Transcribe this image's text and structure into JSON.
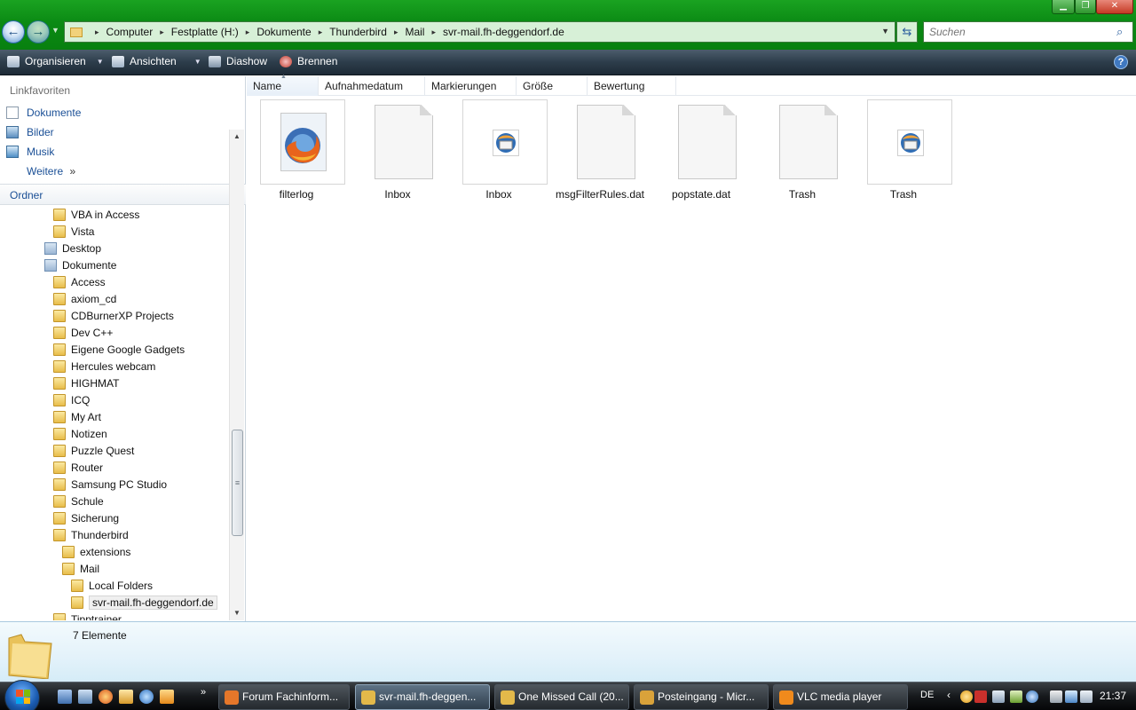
{
  "window": {
    "controls": {
      "minimize": "▁",
      "maximize": "❐",
      "close": "✕"
    }
  },
  "address": {
    "crumbs": [
      "Computer",
      "Festplatte (H:)",
      "Dokumente",
      "Thunderbird",
      "Mail",
      "svr-mail.fh-deggendorf.de"
    ],
    "separator": "▸"
  },
  "search": {
    "placeholder": "Suchen",
    "icon": "search-icon"
  },
  "commandbar": {
    "organize": "Organisieren",
    "views": "Ansichten",
    "slideshow": "Diashow",
    "burn": "Brennen",
    "help": "?"
  },
  "sidebar": {
    "favorites_title": "Linkfavoriten",
    "favorites": [
      {
        "label": "Dokumente",
        "icon": "document-icon"
      },
      {
        "label": "Bilder",
        "icon": "pictures-icon"
      },
      {
        "label": "Musik",
        "icon": "music-icon"
      }
    ],
    "more_label": "Weitere",
    "more_chevron": "»",
    "folders_title": "Ordner",
    "folders_chevron": "⌄",
    "tree": [
      {
        "label": "VBA in Access",
        "type": "folder",
        "depth": 2
      },
      {
        "label": "Vista",
        "type": "folder",
        "depth": 2
      },
      {
        "label": "Desktop",
        "type": "library",
        "depth": 1
      },
      {
        "label": "Dokumente",
        "type": "library",
        "depth": 1
      },
      {
        "label": "Access",
        "type": "folder",
        "depth": 2
      },
      {
        "label": "axiom_cd",
        "type": "folder",
        "depth": 2
      },
      {
        "label": "CDBurnerXP Projects",
        "type": "folder",
        "depth": 2
      },
      {
        "label": "Dev C++",
        "type": "folder",
        "depth": 2
      },
      {
        "label": "Eigene Google Gadgets",
        "type": "folder",
        "depth": 2
      },
      {
        "label": "Hercules webcam",
        "type": "folder",
        "depth": 2
      },
      {
        "label": "HIGHMAT",
        "type": "folder",
        "depth": 2
      },
      {
        "label": "ICQ",
        "type": "folder",
        "depth": 2
      },
      {
        "label": "My Art",
        "type": "folder",
        "depth": 2
      },
      {
        "label": "Notizen",
        "type": "folder",
        "depth": 2
      },
      {
        "label": "Puzzle Quest",
        "type": "folder",
        "depth": 2
      },
      {
        "label": "Router",
        "type": "folder",
        "depth": 2
      },
      {
        "label": "Samsung PC Studio",
        "type": "folder",
        "depth": 2
      },
      {
        "label": "Schule",
        "type": "folder",
        "depth": 2
      },
      {
        "label": "Sicherung",
        "type": "folder",
        "depth": 2
      },
      {
        "label": "Thunderbird",
        "type": "folder",
        "depth": 2
      },
      {
        "label": "extensions",
        "type": "folder",
        "depth": 3
      },
      {
        "label": "Mail",
        "type": "folder",
        "depth": 3
      },
      {
        "label": "Local Folders",
        "type": "folder",
        "depth": 4
      },
      {
        "label": "svr-mail.fh-deggendorf.de",
        "type": "folder",
        "depth": 4,
        "selected": true
      },
      {
        "label": "Tipptrainer",
        "type": "folder",
        "depth": 2
      }
    ]
  },
  "columns": [
    {
      "label": "Name",
      "sorted": true
    },
    {
      "label": "Aufnahmedatum"
    },
    {
      "label": "Markierungen"
    },
    {
      "label": "Größe"
    },
    {
      "label": "Bewertung"
    }
  ],
  "files": [
    {
      "name": "filterlog",
      "icon": "firefox-icon"
    },
    {
      "name": "Inbox",
      "icon": "blank-file-icon"
    },
    {
      "name": "Inbox",
      "icon": "thunderbird-icon"
    },
    {
      "name": "msgFilterRules.dat",
      "icon": "blank-file-icon"
    },
    {
      "name": "popstate.dat",
      "icon": "blank-file-icon"
    },
    {
      "name": "Trash",
      "icon": "blank-file-icon"
    },
    {
      "name": "Trash",
      "icon": "thunderbird-icon"
    }
  ],
  "details": {
    "count": "7 Elemente"
  },
  "taskbar": {
    "quicklaunch_more": "»",
    "tasks": [
      {
        "label": "Forum Fachinform...",
        "icon": "firefox-icon",
        "color": "#e5772a"
      },
      {
        "label": "svr-mail.fh-deggen...",
        "icon": "folder-icon",
        "color": "#e3b94a",
        "active": true
      },
      {
        "label": "One Missed Call (20...",
        "icon": "folder-icon",
        "color": "#e3b94a"
      },
      {
        "label": "Posteingang - Micr...",
        "icon": "mail-icon",
        "color": "#d9a23a"
      },
      {
        "label": "VLC media player",
        "icon": "vlc-icon",
        "color": "#f08a1c"
      }
    ],
    "language": "DE",
    "tray_arrow": "‹",
    "clock": "21:37"
  },
  "colors": {
    "title_green": "#0b8a14",
    "command_dark": "#2d3d4b",
    "link_blue": "#1a4f96",
    "details_blue": "#e3f2fa"
  }
}
